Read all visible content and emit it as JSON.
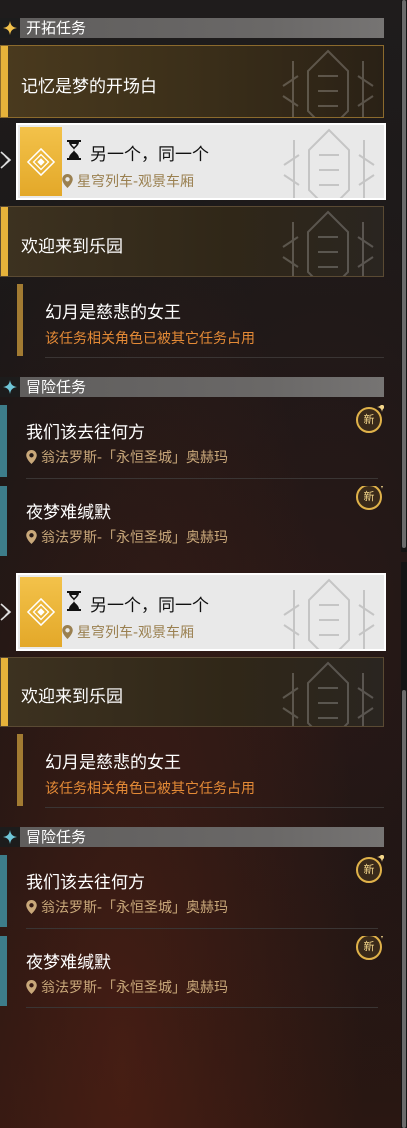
{
  "colors": {
    "gold": "#e6b23a",
    "teal": "#3d7d8a",
    "warning": "#e48a36",
    "location_gold": "#c9a87a",
    "location_dark": "#9a8050"
  },
  "panel_a": {
    "trailblaze_category": {
      "title": "开拓任务",
      "icon": "trailblaze-icon"
    },
    "missions": {
      "memory": {
        "title": "记忆是梦的开场白"
      },
      "another": {
        "title": "另一个，同一个",
        "location": "星穹列车-观景车厢",
        "status_icon": "hourglass-icon"
      },
      "welcome": {
        "title": "欢迎来到乐园"
      },
      "queen": {
        "title": "幻月是慈悲的女王",
        "warning": "该任务相关角色已被其它任务占用"
      }
    },
    "adventure_category": {
      "title": "冒险任务",
      "icon": "adventure-icon"
    },
    "adventures": {
      "where": {
        "title": "我们该去往何方",
        "location": "翁法罗斯-「永恒圣城」奥赫玛",
        "badge": "新"
      },
      "nightmare": {
        "title": "夜梦难缄默",
        "location": "翁法罗斯-「永恒圣城」奥赫玛",
        "badge": "新"
      }
    }
  },
  "panel_b": {
    "missions": {
      "another": {
        "title": "另一个，同一个",
        "location": "星穹列车-观景车厢",
        "status_icon": "hourglass-icon"
      },
      "welcome": {
        "title": "欢迎来到乐园"
      },
      "queen": {
        "title": "幻月是慈悲的女王",
        "warning": "该任务相关角色已被其它任务占用"
      }
    },
    "adventure_category": {
      "title": "冒险任务",
      "icon": "adventure-icon"
    },
    "adventures": {
      "where": {
        "title": "我们该去往何方",
        "location": "翁法罗斯-「永恒圣城」奥赫玛",
        "badge": "新"
      },
      "nightmare": {
        "title": "夜梦难缄默",
        "location": "翁法罗斯-「永恒圣城」奥赫玛",
        "badge": "新"
      }
    }
  }
}
